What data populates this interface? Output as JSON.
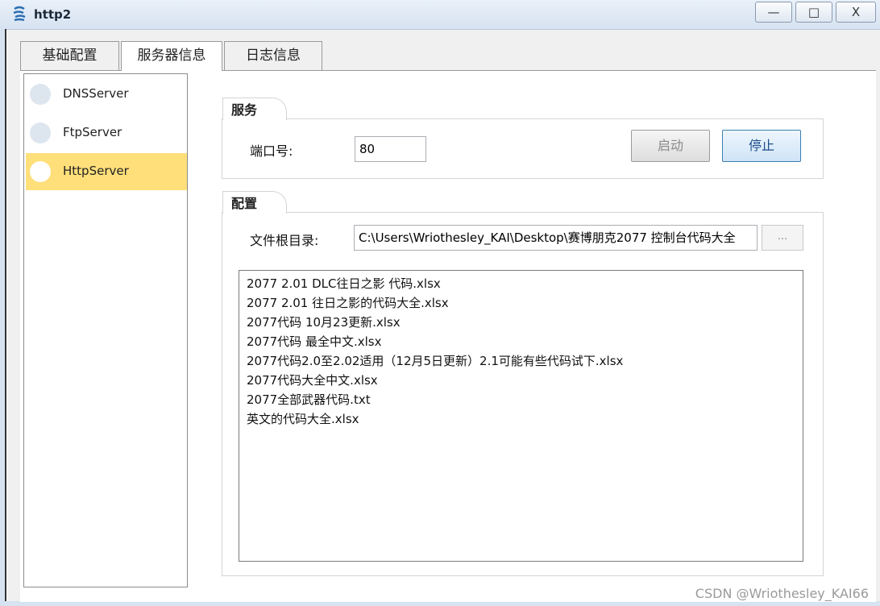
{
  "window": {
    "title": "http2",
    "minimize_label": "—",
    "maximize_label": "□",
    "close_label": "X"
  },
  "tabs": [
    {
      "label": "基础配置"
    },
    {
      "label": "服务器信息"
    },
    {
      "label": "日志信息"
    }
  ],
  "active_tab_index": 1,
  "sidebar": {
    "items": [
      {
        "label": "DNSServer"
      },
      {
        "label": "FtpServer"
      },
      {
        "label": "HttpServer"
      }
    ],
    "selected_index": 2
  },
  "service": {
    "title": "服务",
    "port_label": "端口号:",
    "port_value": "80",
    "start_label": "启动",
    "stop_label": "停止"
  },
  "config": {
    "title": "配置",
    "root_label": "文件根目录:",
    "root_value": "C:\\Users\\Wriothesley_KAI\\Desktop\\赛博朋克2077 控制台代码大全",
    "browse_label": "...",
    "files": [
      "2077 2.01 DLC往日之影 代码.xlsx",
      "2077 2.01 往日之影的代码大全.xlsx",
      "2077代码 10月23更新.xlsx",
      "2077代码 最全中文.xlsx",
      "2077代码2.0至2.02适用（12月5日更新）2.1可能有些代码试下.xlsx",
      "2077代码大全中文.xlsx",
      "2077全部武器代码.txt",
      "英文的代码大全.xlsx"
    ]
  },
  "watermark": "CSDN @Wriothesley_KAI66",
  "colors": {
    "selected_item": "#ffdf7a",
    "titlebar": "#d7e3f1"
  }
}
